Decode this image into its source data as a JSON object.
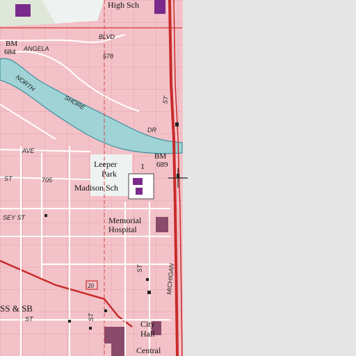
{
  "colors": {
    "urban": "#f3c2c8",
    "urban_dark": "#e9a9b2",
    "water": "#9fd3d6",
    "water_edge": "#3d8fa0",
    "park": "#eef2f0",
    "offmap": "#e5e5e5",
    "road_major": "#d33a3a",
    "road_grid": "#c92a2a",
    "building": "#333333",
    "school": "#7a2a8a",
    "hospital": "#8a4a6a",
    "county_line": "#d33a3a",
    "crosshair": "#222222"
  },
  "labels": {
    "high_sch": "High Sch",
    "blvd": "BLVD",
    "angela": "ANGELA",
    "bm_684_a": "BM",
    "bm_684_b": "684",
    "num_578": "578",
    "north": "NORTH",
    "shore": "SHORE",
    "dr": "DR",
    "st_upper": "ST",
    "ave": "AVE",
    "bm_689_a": "BM",
    "bm_689_b": "689",
    "leeper": "Leeper",
    "park": "Park",
    "madison_sch": "Madison Sch",
    "num_705": "705",
    "st_left": "ST",
    "sey_st": "SEY  ST",
    "memorial": "Memorial",
    "hospital": "Hospital",
    "michigan": "MICHIGAN",
    "st_mid": "ST",
    "route_20": "20",
    "ss_sb": "SS  &  SB",
    "st_low": "ST",
    "st_bottom": "ST",
    "city": "City",
    "hall": "Hall",
    "central": "Central",
    "route_1": "1"
  },
  "icons": {
    "center_marker": "crosshair-icon"
  }
}
